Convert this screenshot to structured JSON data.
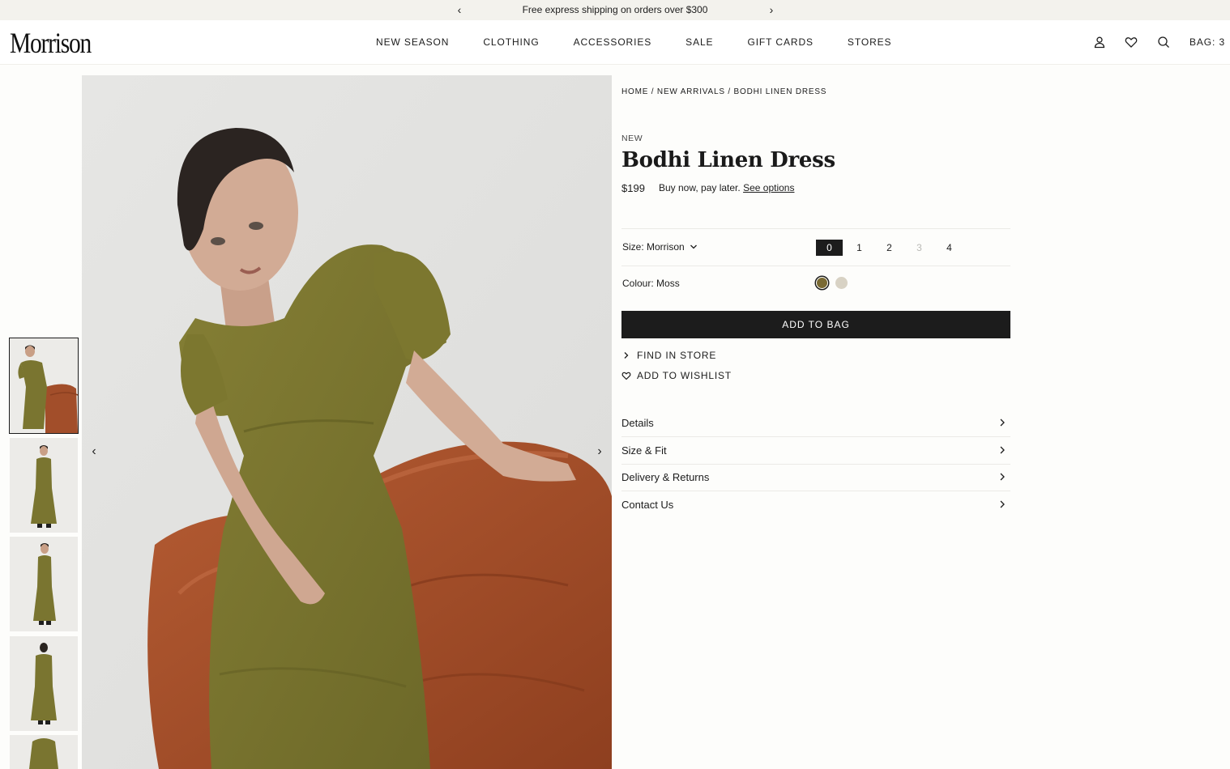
{
  "announcement": {
    "text": "Free express shipping on orders over $300",
    "prev_label": "‹",
    "next_label": "›"
  },
  "header": {
    "logo": "Morrison",
    "nav": [
      "NEW SEASON",
      "CLOTHING",
      "ACCESSORIES",
      "SALE",
      "GIFT CARDS",
      "STORES"
    ],
    "icons": [
      "account-icon",
      "wishlist-heart-icon",
      "search-icon"
    ],
    "bag_label": "BAG: 3"
  },
  "gallery": {
    "thumbnails": [
      "thumbnail-1",
      "thumbnail-2",
      "thumbnail-3",
      "thumbnail-4",
      "thumbnail-5"
    ],
    "active_thumbnail": 0,
    "prev_label": "‹",
    "next_label": "›"
  },
  "product": {
    "breadcrumb": "HOME / NEW ARRIVALS / BODHI LINEN DRESS",
    "badge": "NEW",
    "title": "Bodhi Linen Dress",
    "price": "$199",
    "bnpl_text": "Buy now, pay later.",
    "bnpl_link": "See options",
    "size_label": "Size: Morrison",
    "sizes": [
      {
        "label": "0",
        "state": "selected"
      },
      {
        "label": "1",
        "state": "available"
      },
      {
        "label": "2",
        "state": "available"
      },
      {
        "label": "3",
        "state": "unavailable"
      },
      {
        "label": "4",
        "state": "available"
      }
    ],
    "colour_label": "Colour: Moss",
    "colours": [
      {
        "name": "moss",
        "hex": "#7a6a33",
        "selected": true
      },
      {
        "name": "oat",
        "hex": "#d8d2c4",
        "selected": false
      }
    ],
    "add_to_bag": "ADD TO BAG",
    "find_in_store": "FIND IN STORE",
    "add_to_wishlist": "ADD TO WISHLIST",
    "accordions": [
      "Details",
      "Size & Fit",
      "Delivery & Returns",
      "Contact Us"
    ]
  },
  "colors": {
    "text": "#1c1c1c",
    "announcement_bg": "#f3f2ed",
    "button_bg": "#1c1c1c",
    "dress": "#7a7530",
    "sofa": "#a24e2a"
  }
}
